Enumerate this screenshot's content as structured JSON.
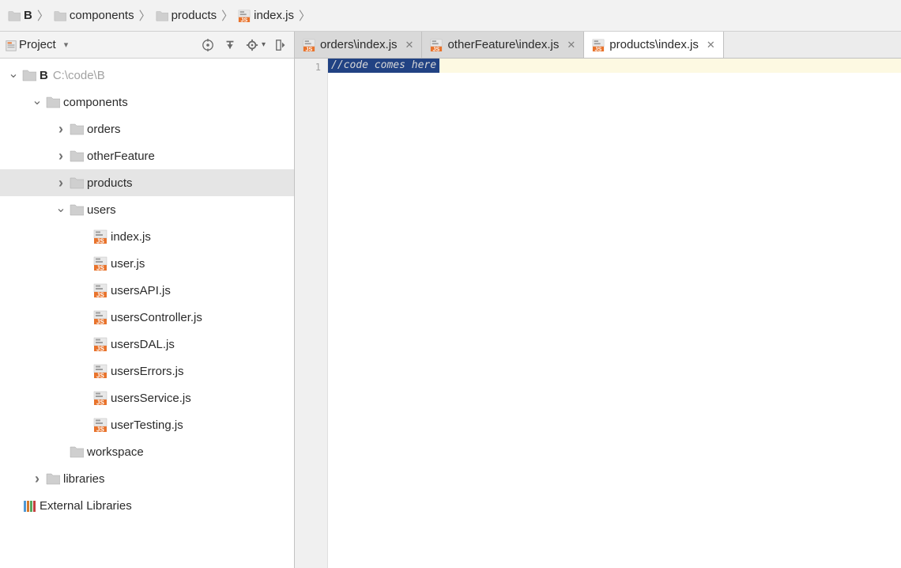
{
  "breadcrumb": [
    {
      "icon": "folder",
      "label": "B",
      "bold": true
    },
    {
      "icon": "folder",
      "label": "components",
      "bold": false
    },
    {
      "icon": "folder",
      "label": "products",
      "bold": false
    },
    {
      "icon": "jsfile",
      "label": "index.js",
      "bold": false
    }
  ],
  "sidebar": {
    "title": "Project",
    "toolbar_icons": [
      "target",
      "collapse",
      "gear",
      "hide"
    ]
  },
  "tree": [
    {
      "depth": 0,
      "arrow": "down",
      "icon": "folder",
      "label": "B",
      "path": "C:\\code\\B",
      "bold": true,
      "selected": false,
      "interactable": true
    },
    {
      "depth": 1,
      "arrow": "down",
      "icon": "folder",
      "label": "components",
      "selected": false,
      "interactable": true
    },
    {
      "depth": 2,
      "arrow": "right",
      "icon": "folder",
      "label": "orders",
      "selected": false,
      "interactable": true
    },
    {
      "depth": 2,
      "arrow": "right",
      "icon": "folder",
      "label": "otherFeature",
      "selected": false,
      "interactable": true
    },
    {
      "depth": 2,
      "arrow": "right",
      "icon": "folder",
      "label": "products",
      "selected": true,
      "interactable": true
    },
    {
      "depth": 2,
      "arrow": "down",
      "icon": "folder",
      "label": "users",
      "selected": false,
      "interactable": true
    },
    {
      "depth": 3,
      "arrow": "none",
      "icon": "jsfile",
      "label": "index.js",
      "selected": false,
      "interactable": true
    },
    {
      "depth": 3,
      "arrow": "none",
      "icon": "jsfile",
      "label": "user.js",
      "selected": false,
      "interactable": true
    },
    {
      "depth": 3,
      "arrow": "none",
      "icon": "jsfile",
      "label": "usersAPI.js",
      "selected": false,
      "interactable": true
    },
    {
      "depth": 3,
      "arrow": "none",
      "icon": "jsfile",
      "label": "usersController.js",
      "selected": false,
      "interactable": true
    },
    {
      "depth": 3,
      "arrow": "none",
      "icon": "jsfile",
      "label": "usersDAL.js",
      "selected": false,
      "interactable": true
    },
    {
      "depth": 3,
      "arrow": "none",
      "icon": "jsfile",
      "label": "usersErrors.js",
      "selected": false,
      "interactable": true
    },
    {
      "depth": 3,
      "arrow": "none",
      "icon": "jsfile",
      "label": "usersService.js",
      "selected": false,
      "interactable": true
    },
    {
      "depth": 3,
      "arrow": "none",
      "icon": "jsfile",
      "label": "userTesting.js",
      "selected": false,
      "interactable": true
    },
    {
      "depth": 2,
      "arrow": "none",
      "icon": "folder",
      "label": "workspace",
      "selected": false,
      "interactable": true
    },
    {
      "depth": 1,
      "arrow": "right",
      "icon": "folder",
      "label": "libraries",
      "selected": false,
      "interactable": true
    },
    {
      "depth": 0,
      "arrow": "none",
      "icon": "extlib",
      "label": "External Libraries",
      "selected": false,
      "interactable": true
    }
  ],
  "tabs": [
    {
      "icon": "jsfile",
      "label": "orders\\index.js",
      "active": false
    },
    {
      "icon": "jsfile",
      "label": "otherFeature\\index.js",
      "active": false
    },
    {
      "icon": "jsfile",
      "label": "products\\index.js",
      "active": true
    }
  ],
  "editor": {
    "gutter_lines": [
      "1"
    ],
    "lines": [
      "//code comes here"
    ]
  }
}
